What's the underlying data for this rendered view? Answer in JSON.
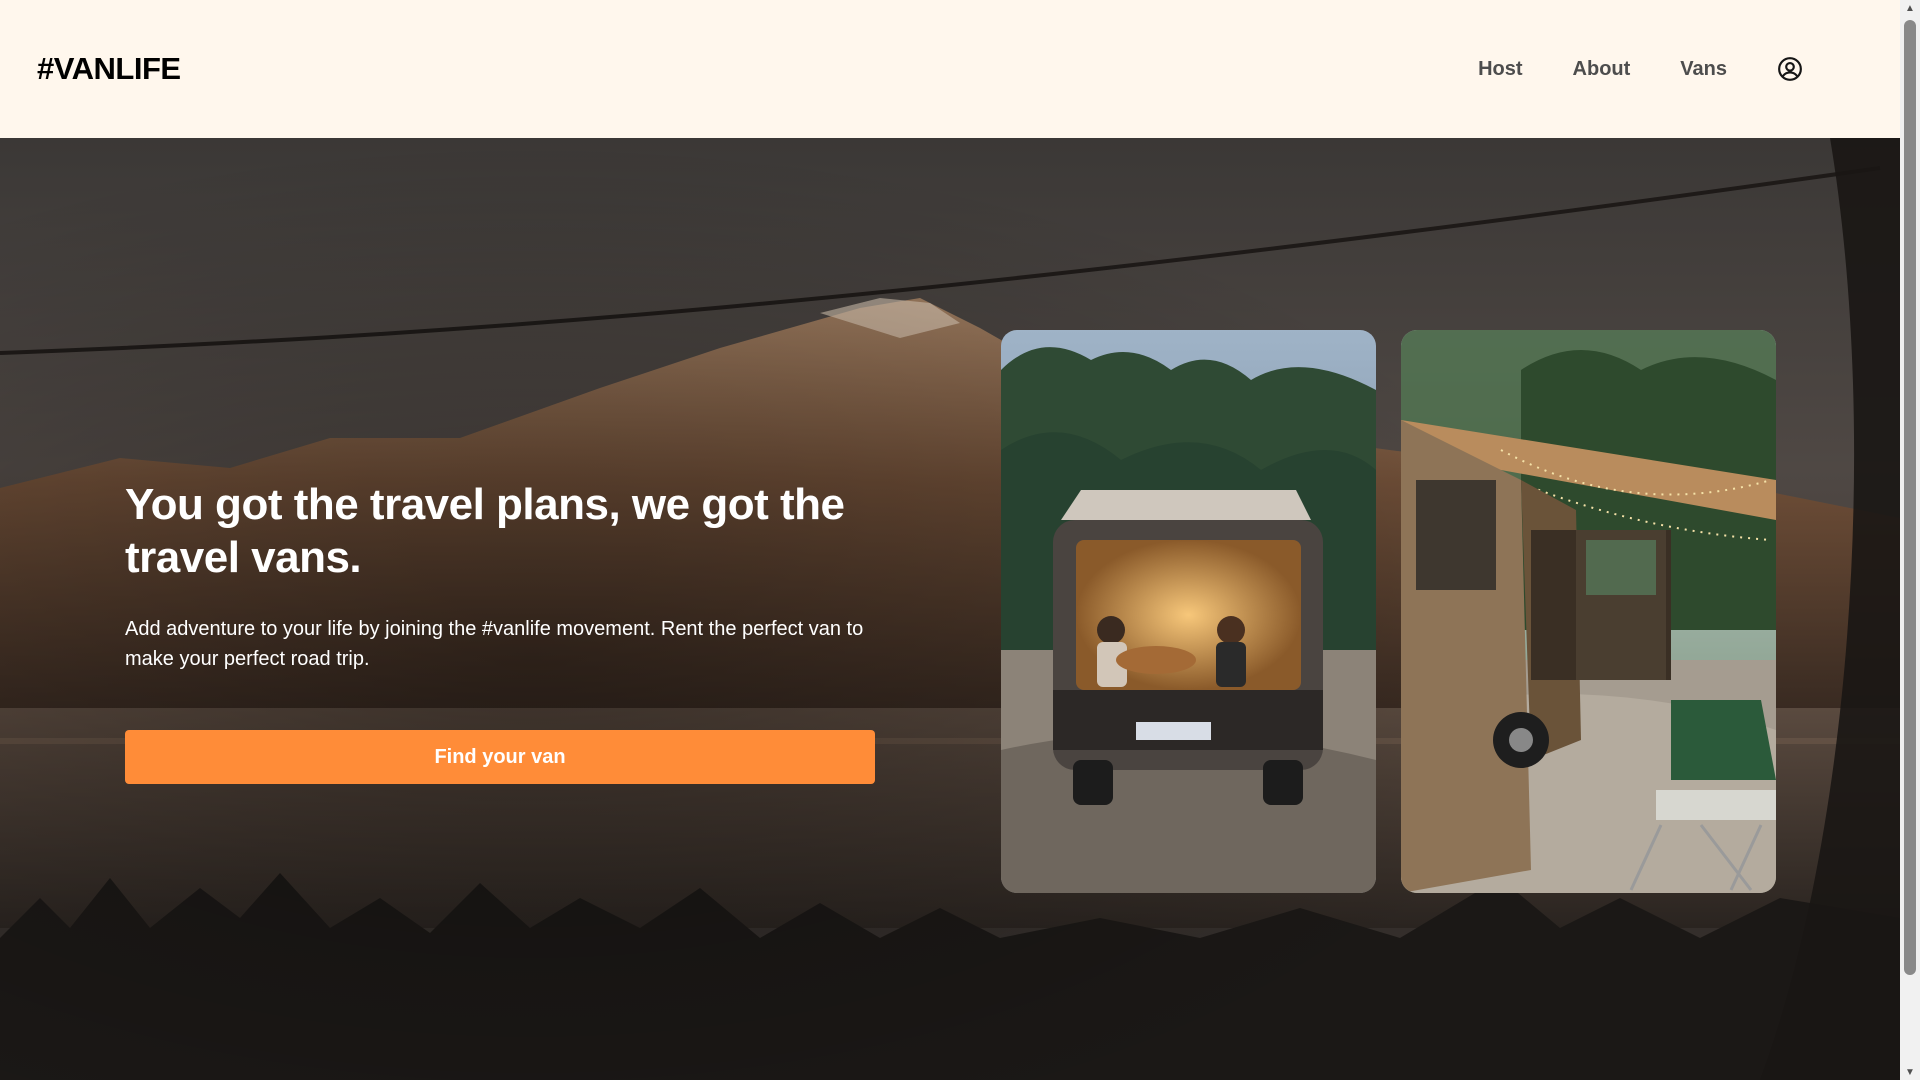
{
  "header": {
    "logo": "#VANLIFE",
    "nav": [
      {
        "label": "Host"
      },
      {
        "label": "About"
      },
      {
        "label": "Vans"
      }
    ],
    "user_icon": "user-circle-icon"
  },
  "hero": {
    "title": "You got the travel plans, we got the travel vans.",
    "subtitle": "Add adventure to your life by joining the #vanlife movement. Rent the perfect van to make your perfect road trip.",
    "cta_label": "Find your van",
    "photos": [
      {
        "icon": "van-couple-photo"
      },
      {
        "icon": "van-camp-photo"
      }
    ]
  },
  "colors": {
    "accent": "#ff8c38",
    "header_bg": "#fff7ed",
    "nav_text": "#4d4d4d"
  }
}
